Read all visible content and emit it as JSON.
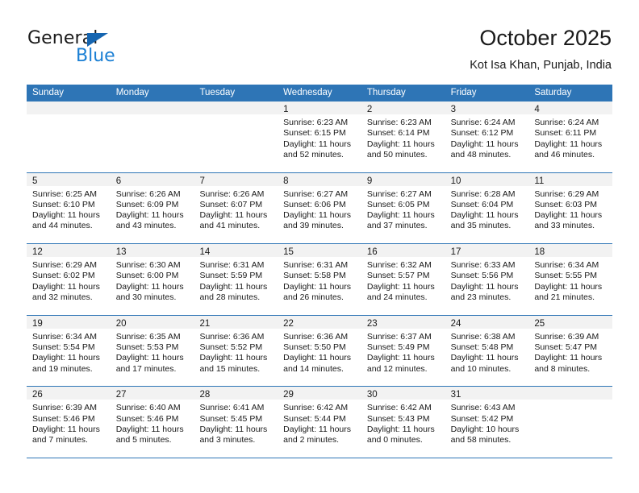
{
  "brand": {
    "word1": "General",
    "word2": "Blue",
    "triangle_icon": "brand-triangle-icon",
    "colors": {
      "general": "#1a1a1a",
      "blue": "#1a7fd4",
      "triangle": "#1565b0"
    }
  },
  "header": {
    "title": "October 2025",
    "subtitle": "Kot Isa Khan, Punjab, India"
  },
  "calendar": {
    "accent_color": "#2e75b6",
    "day_band_color": "#f2f2f2",
    "weekdays": [
      "Sunday",
      "Monday",
      "Tuesday",
      "Wednesday",
      "Thursday",
      "Friday",
      "Saturday"
    ],
    "weeks": [
      [
        {
          "day": "",
          "lines": []
        },
        {
          "day": "",
          "lines": []
        },
        {
          "day": "",
          "lines": []
        },
        {
          "day": "1",
          "lines": [
            "Sunrise: 6:23 AM",
            "Sunset: 6:15 PM",
            "Daylight: 11 hours",
            "and 52 minutes."
          ]
        },
        {
          "day": "2",
          "lines": [
            "Sunrise: 6:23 AM",
            "Sunset: 6:14 PM",
            "Daylight: 11 hours",
            "and 50 minutes."
          ]
        },
        {
          "day": "3",
          "lines": [
            "Sunrise: 6:24 AM",
            "Sunset: 6:12 PM",
            "Daylight: 11 hours",
            "and 48 minutes."
          ]
        },
        {
          "day": "4",
          "lines": [
            "Sunrise: 6:24 AM",
            "Sunset: 6:11 PM",
            "Daylight: 11 hours",
            "and 46 minutes."
          ]
        }
      ],
      [
        {
          "day": "5",
          "lines": [
            "Sunrise: 6:25 AM",
            "Sunset: 6:10 PM",
            "Daylight: 11 hours",
            "and 44 minutes."
          ]
        },
        {
          "day": "6",
          "lines": [
            "Sunrise: 6:26 AM",
            "Sunset: 6:09 PM",
            "Daylight: 11 hours",
            "and 43 minutes."
          ]
        },
        {
          "day": "7",
          "lines": [
            "Sunrise: 6:26 AM",
            "Sunset: 6:07 PM",
            "Daylight: 11 hours",
            "and 41 minutes."
          ]
        },
        {
          "day": "8",
          "lines": [
            "Sunrise: 6:27 AM",
            "Sunset: 6:06 PM",
            "Daylight: 11 hours",
            "and 39 minutes."
          ]
        },
        {
          "day": "9",
          "lines": [
            "Sunrise: 6:27 AM",
            "Sunset: 6:05 PM",
            "Daylight: 11 hours",
            "and 37 minutes."
          ]
        },
        {
          "day": "10",
          "lines": [
            "Sunrise: 6:28 AM",
            "Sunset: 6:04 PM",
            "Daylight: 11 hours",
            "and 35 minutes."
          ]
        },
        {
          "day": "11",
          "lines": [
            "Sunrise: 6:29 AM",
            "Sunset: 6:03 PM",
            "Daylight: 11 hours",
            "and 33 minutes."
          ]
        }
      ],
      [
        {
          "day": "12",
          "lines": [
            "Sunrise: 6:29 AM",
            "Sunset: 6:02 PM",
            "Daylight: 11 hours",
            "and 32 minutes."
          ]
        },
        {
          "day": "13",
          "lines": [
            "Sunrise: 6:30 AM",
            "Sunset: 6:00 PM",
            "Daylight: 11 hours",
            "and 30 minutes."
          ]
        },
        {
          "day": "14",
          "lines": [
            "Sunrise: 6:31 AM",
            "Sunset: 5:59 PM",
            "Daylight: 11 hours",
            "and 28 minutes."
          ]
        },
        {
          "day": "15",
          "lines": [
            "Sunrise: 6:31 AM",
            "Sunset: 5:58 PM",
            "Daylight: 11 hours",
            "and 26 minutes."
          ]
        },
        {
          "day": "16",
          "lines": [
            "Sunrise: 6:32 AM",
            "Sunset: 5:57 PM",
            "Daylight: 11 hours",
            "and 24 minutes."
          ]
        },
        {
          "day": "17",
          "lines": [
            "Sunrise: 6:33 AM",
            "Sunset: 5:56 PM",
            "Daylight: 11 hours",
            "and 23 minutes."
          ]
        },
        {
          "day": "18",
          "lines": [
            "Sunrise: 6:34 AM",
            "Sunset: 5:55 PM",
            "Daylight: 11 hours",
            "and 21 minutes."
          ]
        }
      ],
      [
        {
          "day": "19",
          "lines": [
            "Sunrise: 6:34 AM",
            "Sunset: 5:54 PM",
            "Daylight: 11 hours",
            "and 19 minutes."
          ]
        },
        {
          "day": "20",
          "lines": [
            "Sunrise: 6:35 AM",
            "Sunset: 5:53 PM",
            "Daylight: 11 hours",
            "and 17 minutes."
          ]
        },
        {
          "day": "21",
          "lines": [
            "Sunrise: 6:36 AM",
            "Sunset: 5:52 PM",
            "Daylight: 11 hours",
            "and 15 minutes."
          ]
        },
        {
          "day": "22",
          "lines": [
            "Sunrise: 6:36 AM",
            "Sunset: 5:50 PM",
            "Daylight: 11 hours",
            "and 14 minutes."
          ]
        },
        {
          "day": "23",
          "lines": [
            "Sunrise: 6:37 AM",
            "Sunset: 5:49 PM",
            "Daylight: 11 hours",
            "and 12 minutes."
          ]
        },
        {
          "day": "24",
          "lines": [
            "Sunrise: 6:38 AM",
            "Sunset: 5:48 PM",
            "Daylight: 11 hours",
            "and 10 minutes."
          ]
        },
        {
          "day": "25",
          "lines": [
            "Sunrise: 6:39 AM",
            "Sunset: 5:47 PM",
            "Daylight: 11 hours",
            "and 8 minutes."
          ]
        }
      ],
      [
        {
          "day": "26",
          "lines": [
            "Sunrise: 6:39 AM",
            "Sunset: 5:46 PM",
            "Daylight: 11 hours",
            "and 7 minutes."
          ]
        },
        {
          "day": "27",
          "lines": [
            "Sunrise: 6:40 AM",
            "Sunset: 5:46 PM",
            "Daylight: 11 hours",
            "and 5 minutes."
          ]
        },
        {
          "day": "28",
          "lines": [
            "Sunrise: 6:41 AM",
            "Sunset: 5:45 PM",
            "Daylight: 11 hours",
            "and 3 minutes."
          ]
        },
        {
          "day": "29",
          "lines": [
            "Sunrise: 6:42 AM",
            "Sunset: 5:44 PM",
            "Daylight: 11 hours",
            "and 2 minutes."
          ]
        },
        {
          "day": "30",
          "lines": [
            "Sunrise: 6:42 AM",
            "Sunset: 5:43 PM",
            "Daylight: 11 hours",
            "and 0 minutes."
          ]
        },
        {
          "day": "31",
          "lines": [
            "Sunrise: 6:43 AM",
            "Sunset: 5:42 PM",
            "Daylight: 10 hours",
            "and 58 minutes."
          ]
        },
        {
          "day": "",
          "lines": []
        }
      ]
    ]
  }
}
